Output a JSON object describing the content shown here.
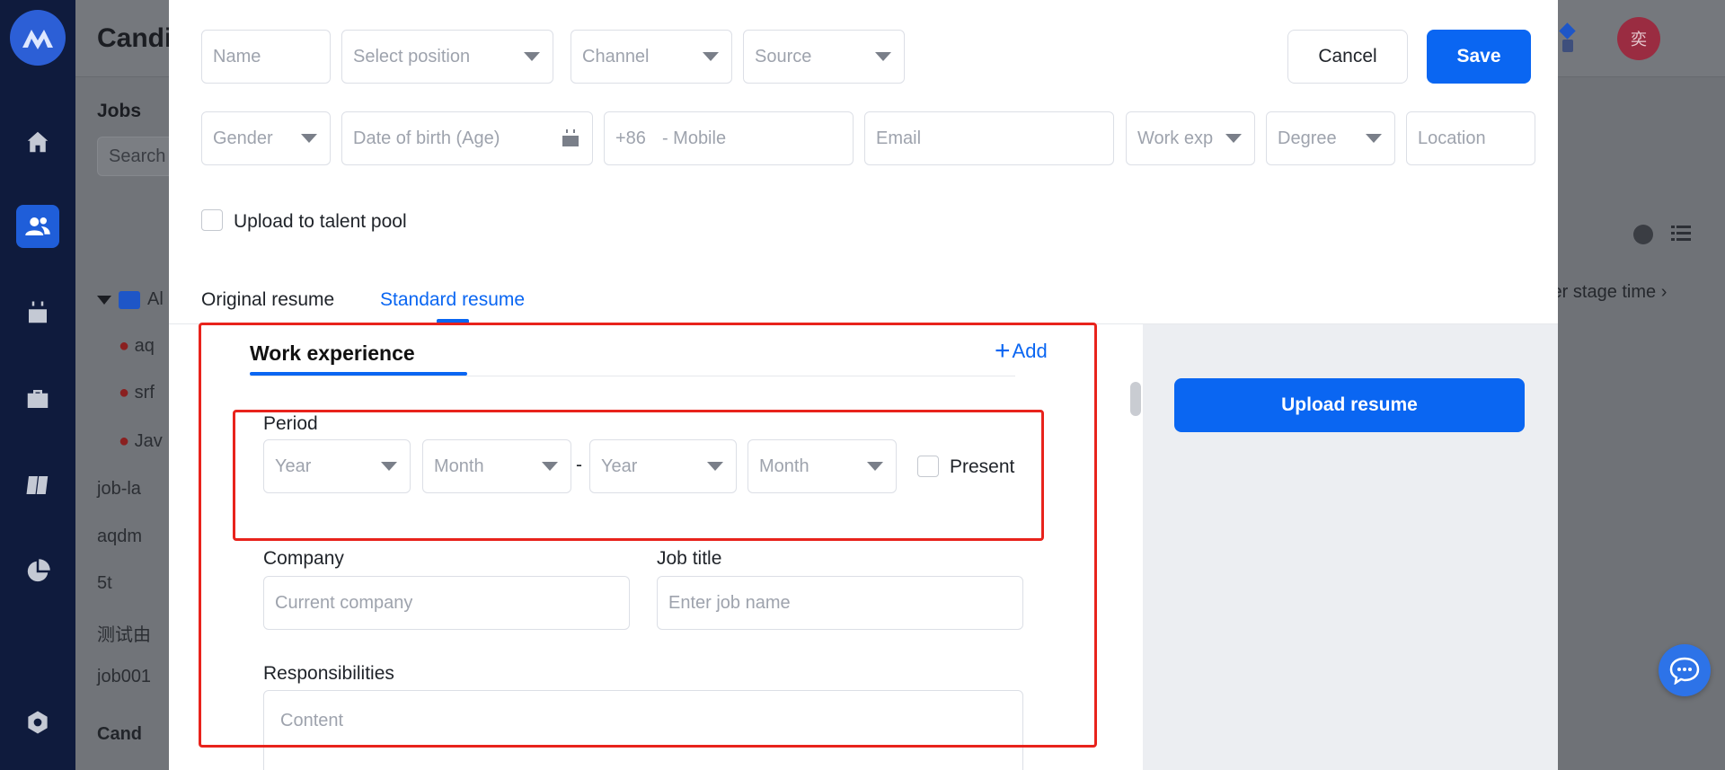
{
  "app": {
    "title": "Candi",
    "avatar_text": "奕",
    "jobs_title": "Jobs",
    "jobs_search_placeholder": "Search",
    "jobs_items": [
      "aq",
      "srf",
      "Jav",
      "job-la",
      "aqdm",
      "5t",
      "测试由",
      "job001"
    ],
    "jobs_group": "Al",
    "footer_label": "Cand",
    "sort_label": "ter stage time"
  },
  "form": {
    "row1": {
      "name_placeholder": "Name",
      "position_placeholder": "Select position",
      "channel_placeholder": "Channel",
      "source_placeholder": "Source"
    },
    "row2": {
      "gender_placeholder": "Gender",
      "dob_placeholder": "Date of birth (Age)",
      "country_code": "+86",
      "mobile_placeholder": "-  Mobile",
      "email_placeholder": "Email",
      "work_exp_placeholder": "Work exp",
      "degree_placeholder": "Degree",
      "location_placeholder": "Location"
    },
    "upload_talent_pool_label": "Upload to talent pool",
    "buttons": {
      "cancel": "Cancel",
      "save": "Save"
    }
  },
  "tabs": [
    {
      "label": "Original resume",
      "active": false
    },
    {
      "label": "Standard resume",
      "active": true
    }
  ],
  "work_experience": {
    "title": "Work experience",
    "add_label": "Add",
    "period_label": "Period",
    "start_year": "Year",
    "start_month": "Month",
    "separator": "-",
    "end_year": "Year",
    "end_month": "Month",
    "present_label": "Present",
    "company_label": "Company",
    "company_placeholder": "Current company",
    "job_title_label": "Job title",
    "job_title_placeholder": "Enter job name",
    "responsibilities_label": "Responsibilities",
    "responsibilities_placeholder": "Content"
  },
  "upload_resume_label": "Upload resume",
  "colors": {
    "primary": "#0a66f2",
    "highlight": "#e8231c",
    "sidebar": "#0f1b3d"
  },
  "icons": {
    "sidebar": [
      "home-icon",
      "users-icon",
      "calendar-icon",
      "briefcase-icon",
      "book-icon",
      "pie-chart-icon",
      "settings-icon"
    ],
    "chat": "chat-icon"
  }
}
